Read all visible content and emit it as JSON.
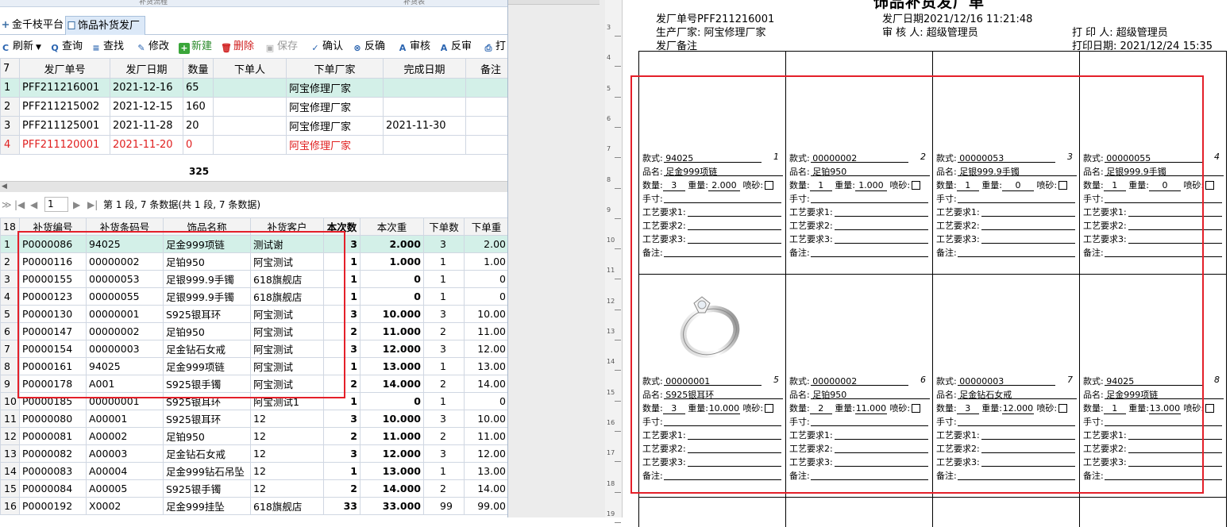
{
  "top_strip": {
    "left": "补货流程",
    "right": "补货表"
  },
  "tabs": [
    {
      "label": "金千枝平台"
    },
    {
      "label": "饰品补货发厂"
    }
  ],
  "toolbar": {
    "refresh": "刷新",
    "query": "查询",
    "find": "查找",
    "edit": "修改",
    "new": "新建",
    "delete": "删除",
    "save": "保存",
    "confirm": "确认",
    "unconfirm": "反确",
    "audit": "审核",
    "unaudit": "反审",
    "print": "打"
  },
  "grid1": {
    "header_count": "7",
    "columns": [
      "发厂单号",
      "发厂日期",
      "数量",
      "下单人",
      "下单厂家",
      "完成日期",
      "备注"
    ],
    "rows": [
      {
        "n": "1",
        "no": "PFF211216001",
        "date": "2021-12-16",
        "qty": "65",
        "person": "",
        "factory": "阿宝修理厂家",
        "done": ""
      },
      {
        "n": "2",
        "no": "PFF211215002",
        "date": "2021-12-15",
        "qty": "160",
        "person": "",
        "factory": "阿宝修理厂家",
        "done": ""
      },
      {
        "n": "3",
        "no": "PFF211125001",
        "date": "2021-11-28",
        "qty": "20",
        "person": "",
        "factory": "阿宝修理厂家",
        "done": "2021-11-30"
      },
      {
        "n": "4",
        "no": "PFF211120001",
        "date": "2021-11-20",
        "qty": "0",
        "person": "",
        "factory": "阿宝修理厂家",
        "done": ""
      }
    ],
    "sum": "325"
  },
  "pager": {
    "page": "1",
    "text": "第 1 段, 7 条数据(共 1 段, 7 条数据)"
  },
  "grid2": {
    "header_count": "18",
    "columns": [
      "补货编号",
      "补货条码号",
      "饰品名称",
      "补货客户",
      "本次数",
      "本次重",
      "下单数",
      "下单重"
    ],
    "rows": [
      {
        "n": "1",
        "id": "P0000086",
        "code": "94025",
        "name": "足金999项链",
        "cust": "测试谢",
        "cnt": "3",
        "wt": "2.000",
        "oc": "3",
        "ow": "2.00"
      },
      {
        "n": "2",
        "id": "P0000116",
        "code": "00000002",
        "name": "足铂950",
        "cust": "阿宝测试",
        "cnt": "1",
        "wt": "1.000",
        "oc": "1",
        "ow": "1.00"
      },
      {
        "n": "3",
        "id": "P0000155",
        "code": "00000053",
        "name": "足银999.9手镯",
        "cust": "618旗舰店",
        "cnt": "1",
        "wt": "0",
        "oc": "1",
        "ow": "0"
      },
      {
        "n": "4",
        "id": "P0000123",
        "code": "00000055",
        "name": "足银999.9手镯",
        "cust": "618旗舰店",
        "cnt": "1",
        "wt": "0",
        "oc": "1",
        "ow": "0"
      },
      {
        "n": "5",
        "id": "P0000130",
        "code": "00000001",
        "name": "S925银耳环",
        "cust": "阿宝测试",
        "cnt": "3",
        "wt": "10.000",
        "oc": "3",
        "ow": "10.00"
      },
      {
        "n": "6",
        "id": "P0000147",
        "code": "00000002",
        "name": "足铂950",
        "cust": "阿宝测试",
        "cnt": "2",
        "wt": "11.000",
        "oc": "2",
        "ow": "11.00"
      },
      {
        "n": "7",
        "id": "P0000154",
        "code": "00000003",
        "name": "足金钻石女戒",
        "cust": "阿宝测试",
        "cnt": "3",
        "wt": "12.000",
        "oc": "3",
        "ow": "12.00"
      },
      {
        "n": "8",
        "id": "P0000161",
        "code": "94025",
        "name": "足金999项链",
        "cust": "阿宝测试",
        "cnt": "1",
        "wt": "13.000",
        "oc": "1",
        "ow": "13.00"
      },
      {
        "n": "9",
        "id": "P0000178",
        "code": "A001",
        "name": "S925银手镯",
        "cust": "阿宝测试",
        "cnt": "2",
        "wt": "14.000",
        "oc": "2",
        "ow": "14.00"
      },
      {
        "n": "10",
        "id": "P0000185",
        "code": "00000001",
        "name": "S925银耳环",
        "cust": "阿宝测试1",
        "cnt": "1",
        "wt": "0",
        "oc": "1",
        "ow": "0"
      },
      {
        "n": "11",
        "id": "P0000080",
        "code": "A00001",
        "name": "S925银耳环",
        "cust": "12",
        "cnt": "3",
        "wt": "10.000",
        "oc": "3",
        "ow": "10.00"
      },
      {
        "n": "12",
        "id": "P0000081",
        "code": "A00002",
        "name": "足铂950",
        "cust": "12",
        "cnt": "2",
        "wt": "11.000",
        "oc": "2",
        "ow": "11.00"
      },
      {
        "n": "13",
        "id": "P0000082",
        "code": "A00003",
        "name": "足金钻石女戒",
        "cust": "12",
        "cnt": "3",
        "wt": "12.000",
        "oc": "3",
        "ow": "12.00"
      },
      {
        "n": "14",
        "id": "P0000083",
        "code": "A00004",
        "name": "足金999钻石吊坠",
        "cust": "12",
        "cnt": "1",
        "wt": "13.000",
        "oc": "1",
        "ow": "13.00"
      },
      {
        "n": "15",
        "id": "P0000084",
        "code": "A00005",
        "name": "S925银手镯",
        "cust": "12",
        "cnt": "2",
        "wt": "14.000",
        "oc": "2",
        "ow": "14.00"
      },
      {
        "n": "16",
        "id": "P0000192",
        "code": "X0002",
        "name": "足金999挂坠",
        "cust": "618旗舰店",
        "cnt": "33",
        "wt": "33.000",
        "oc": "99",
        "ow": "99.00"
      }
    ]
  },
  "ruler": [
    "3",
    "4",
    "5",
    "6",
    "7",
    "8",
    "9",
    "10",
    "11",
    "12",
    "13",
    "14",
    "15",
    "16",
    "17",
    "18",
    "19"
  ],
  "report": {
    "title": "饰品补货发厂单",
    "order_no": "发厂单号PFF211216001",
    "date": "发厂日期2021/12/16 11:21:48",
    "factory": "生产厂家: 阿宝修理厂家",
    "auditor": "审 核 人: 超级管理员",
    "printer": "打 印 人: 超级管理员",
    "remark": "发厂备注",
    "print_date": "打印日期: 2021/12/24 15:35",
    "labels": {
      "style": "款式:",
      "name": "品名:",
      "qty": "数量:",
      "weight": "重量:",
      "spray": "喷砂:",
      "hand": "手寸:",
      "req1": "工艺要求1:",
      "req2": "工艺要求2:",
      "req3": "工艺要求3:",
      "note": "备注:"
    },
    "cards": [
      {
        "style": "94025",
        "idx": "1",
        "name": "足金999项链",
        "qty": "3",
        "weight": "2.000"
      },
      {
        "style": "00000002",
        "idx": "2",
        "name": "足铂950",
        "qty": "1",
        "weight": "1.000"
      },
      {
        "style": "00000053",
        "idx": "3",
        "name": "足银999.9手镯",
        "qty": "1",
        "weight": "0"
      },
      {
        "style": "00000055",
        "idx": "4",
        "name": "足银999.9手镯",
        "qty": "1",
        "weight": "0"
      },
      {
        "style": "00000001",
        "idx": "5",
        "name": "S925银耳环",
        "qty": "3",
        "weight": "10.000"
      },
      {
        "style": "00000002",
        "idx": "6",
        "name": "足铂950",
        "qty": "2",
        "weight": "11.000"
      },
      {
        "style": "00000003",
        "idx": "7",
        "name": "足金钻石女戒",
        "qty": "3",
        "weight": "12.000"
      },
      {
        "style": "94025",
        "idx": "8",
        "name": "足金999项链",
        "qty": "1",
        "weight": "13.000"
      }
    ]
  },
  "colors": {
    "selected_row": "#d3f0e8",
    "red_text": "#e02020",
    "annotation_box": "#e4202a"
  }
}
